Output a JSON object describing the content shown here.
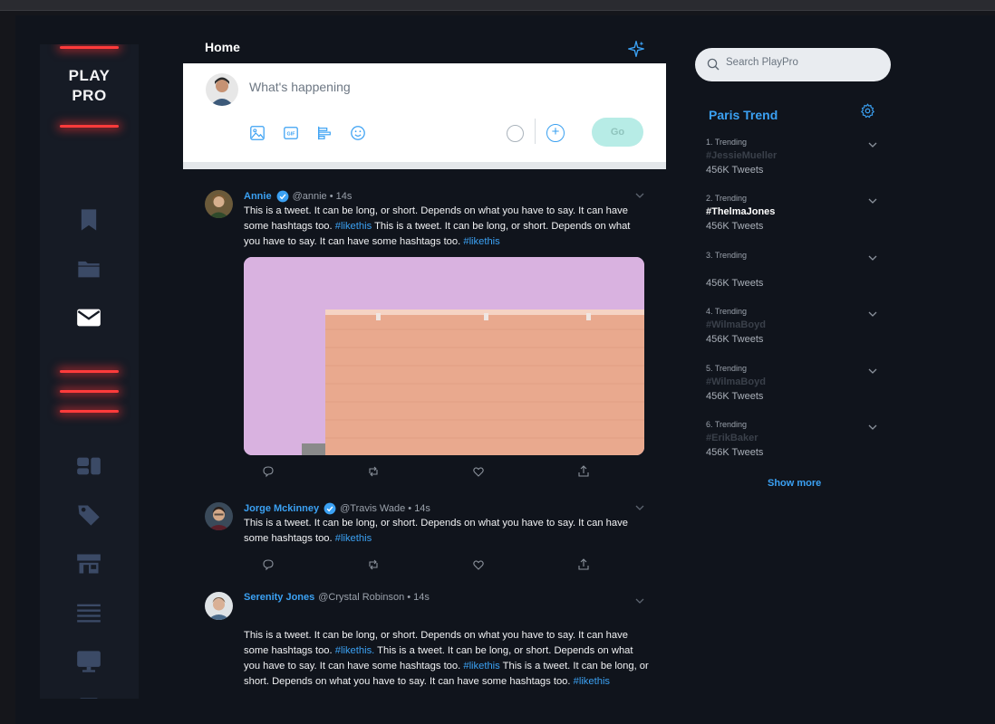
{
  "brand": {
    "line1": "PLAY",
    "line2": "PRO"
  },
  "sidebar": {
    "items": [
      {
        "icon": "bookmark-icon"
      },
      {
        "icon": "folder-icon"
      },
      {
        "icon": "mail-icon"
      },
      {
        "icon": "dashboard-icon"
      },
      {
        "icon": "tag-icon"
      },
      {
        "icon": "store-icon"
      },
      {
        "icon": "list-icon"
      },
      {
        "icon": "monitor-icon"
      }
    ]
  },
  "header": {
    "title": "Home"
  },
  "compose": {
    "placeholder": "What's happening",
    "go_label": "Go",
    "add_label": "+"
  },
  "tweets": [
    {
      "name": "Annie",
      "handle": "@annie",
      "time": "14s",
      "meta": "@annie • 14s",
      "verified": true,
      "text": [
        "This is a tweet. It can be long, or short. Depends on what you have to say. It can have some hashtags too. ",
        "#likethis",
        " This is a tweet. It can be long, or short. Depends on what you have to say. It can have some hashtags too. ",
        "#likethis"
      ]
    },
    {
      "name": "Jorge Mckinney",
      "handle": "@Travis Wade",
      "time": "14s",
      "meta": "@Travis Wade • 14s",
      "verified": true,
      "text": [
        "This is a tweet. It can be long, or short. Depends on what you have to say. It can have some hashtags too. ",
        "#likethis"
      ]
    },
    {
      "name": "Serenity Jones",
      "handle": "@Crystal Robinson",
      "time": "14s",
      "meta": "@Crystal Robinson • 14s",
      "verified": false,
      "text": [
        "This is a tweet. It can be long, or short. Depends on what you have to say. It can have some hashtags too. ",
        "#likethis.",
        " This is a tweet. It can be long, or short. Depends on what you have to say. It can have some hashtags too. ",
        "#likethis",
        " This is a tweet. It can be long, or short. Depends on what you have to say. It can have some hashtags too. ",
        "#likethis"
      ]
    }
  ],
  "search": {
    "placeholder": "Search PlayPro"
  },
  "trends": {
    "title": "Paris Trend",
    "show_more": "Show more",
    "items": [
      {
        "rank": "1. Trending",
        "tag": "#JessieMueller",
        "count": "456K Tweets",
        "highlight": false
      },
      {
        "rank": "2. Trending",
        "tag": "#ThelmaJones",
        "count": "456K Tweets",
        "highlight": true
      },
      {
        "rank": "3. Trending",
        "tag": "",
        "count": "456K Tweets",
        "highlight": false
      },
      {
        "rank": "4. Trending",
        "tag": "#WilmaBoyd",
        "count": "456K Tweets",
        "highlight": false
      },
      {
        "rank": "5. Trending",
        "tag": "#WilmaBoyd",
        "count": "456K Tweets",
        "highlight": false
      },
      {
        "rank": "6. Trending",
        "tag": "#ErikBaker",
        "count": "456K Tweets",
        "highlight": false
      }
    ]
  },
  "colors": {
    "accent": "#3ba1f3",
    "neon_red": "#ff3b3b",
    "background": "#10141c",
    "sidebar": "#161b25"
  }
}
